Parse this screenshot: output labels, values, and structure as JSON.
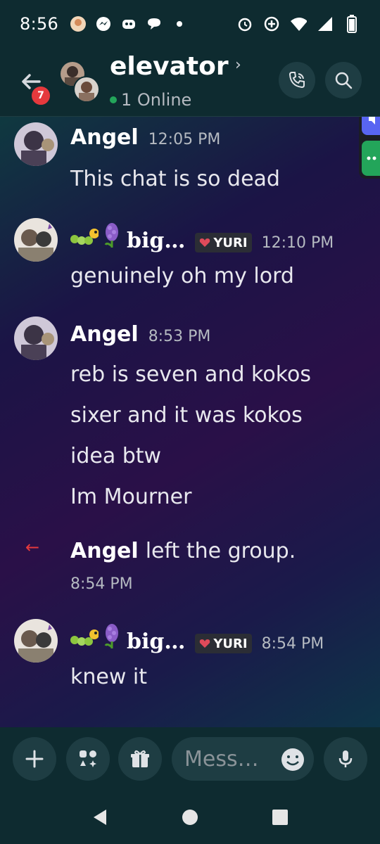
{
  "status_bar": {
    "time": "8:56",
    "icons": [
      "app-avatar-icon",
      "messenger-icon",
      "discord-icon",
      "chat-bubble-icon",
      "dot-icon",
      "alarm-icon",
      "data-saver-icon",
      "wifi-icon",
      "signal-icon",
      "battery-icon"
    ]
  },
  "header": {
    "back_badge": "7",
    "title": "elevator",
    "title_chevron": "›",
    "online_text": "1 Online"
  },
  "messages": [
    {
      "user": "Angel",
      "time": "12:05 PM",
      "lines": [
        "This chat is so dead"
      ]
    },
    {
      "user": "big…",
      "prefix_emojis": [
        "caterpillar-icon",
        "hyacinth-icon"
      ],
      "tag": "YURI",
      "time": "12:10 PM",
      "lines": [
        "genuinely oh my lord"
      ]
    },
    {
      "user": "Angel",
      "time": "8:53 PM",
      "lines": [
        "reb is seven and kokos",
        "sixer and it was kokos",
        "idea btw",
        "Im Mourner"
      ]
    },
    {
      "system": true,
      "user": "Angel",
      "text": "left the group.",
      "time": "8:54 PM"
    },
    {
      "user": "big…",
      "prefix_emojis": [
        "caterpillar-icon",
        "hyacinth-icon"
      ],
      "tag": "YURI",
      "time": "8:54 PM",
      "lines": [
        "knew it"
      ]
    }
  ],
  "composer": {
    "placeholder": "Mess…"
  },
  "colors": {
    "background": "#0e2b30",
    "accent_blue": "#5865f2",
    "online_green": "#23a55a",
    "badge_red": "#e5393d"
  }
}
